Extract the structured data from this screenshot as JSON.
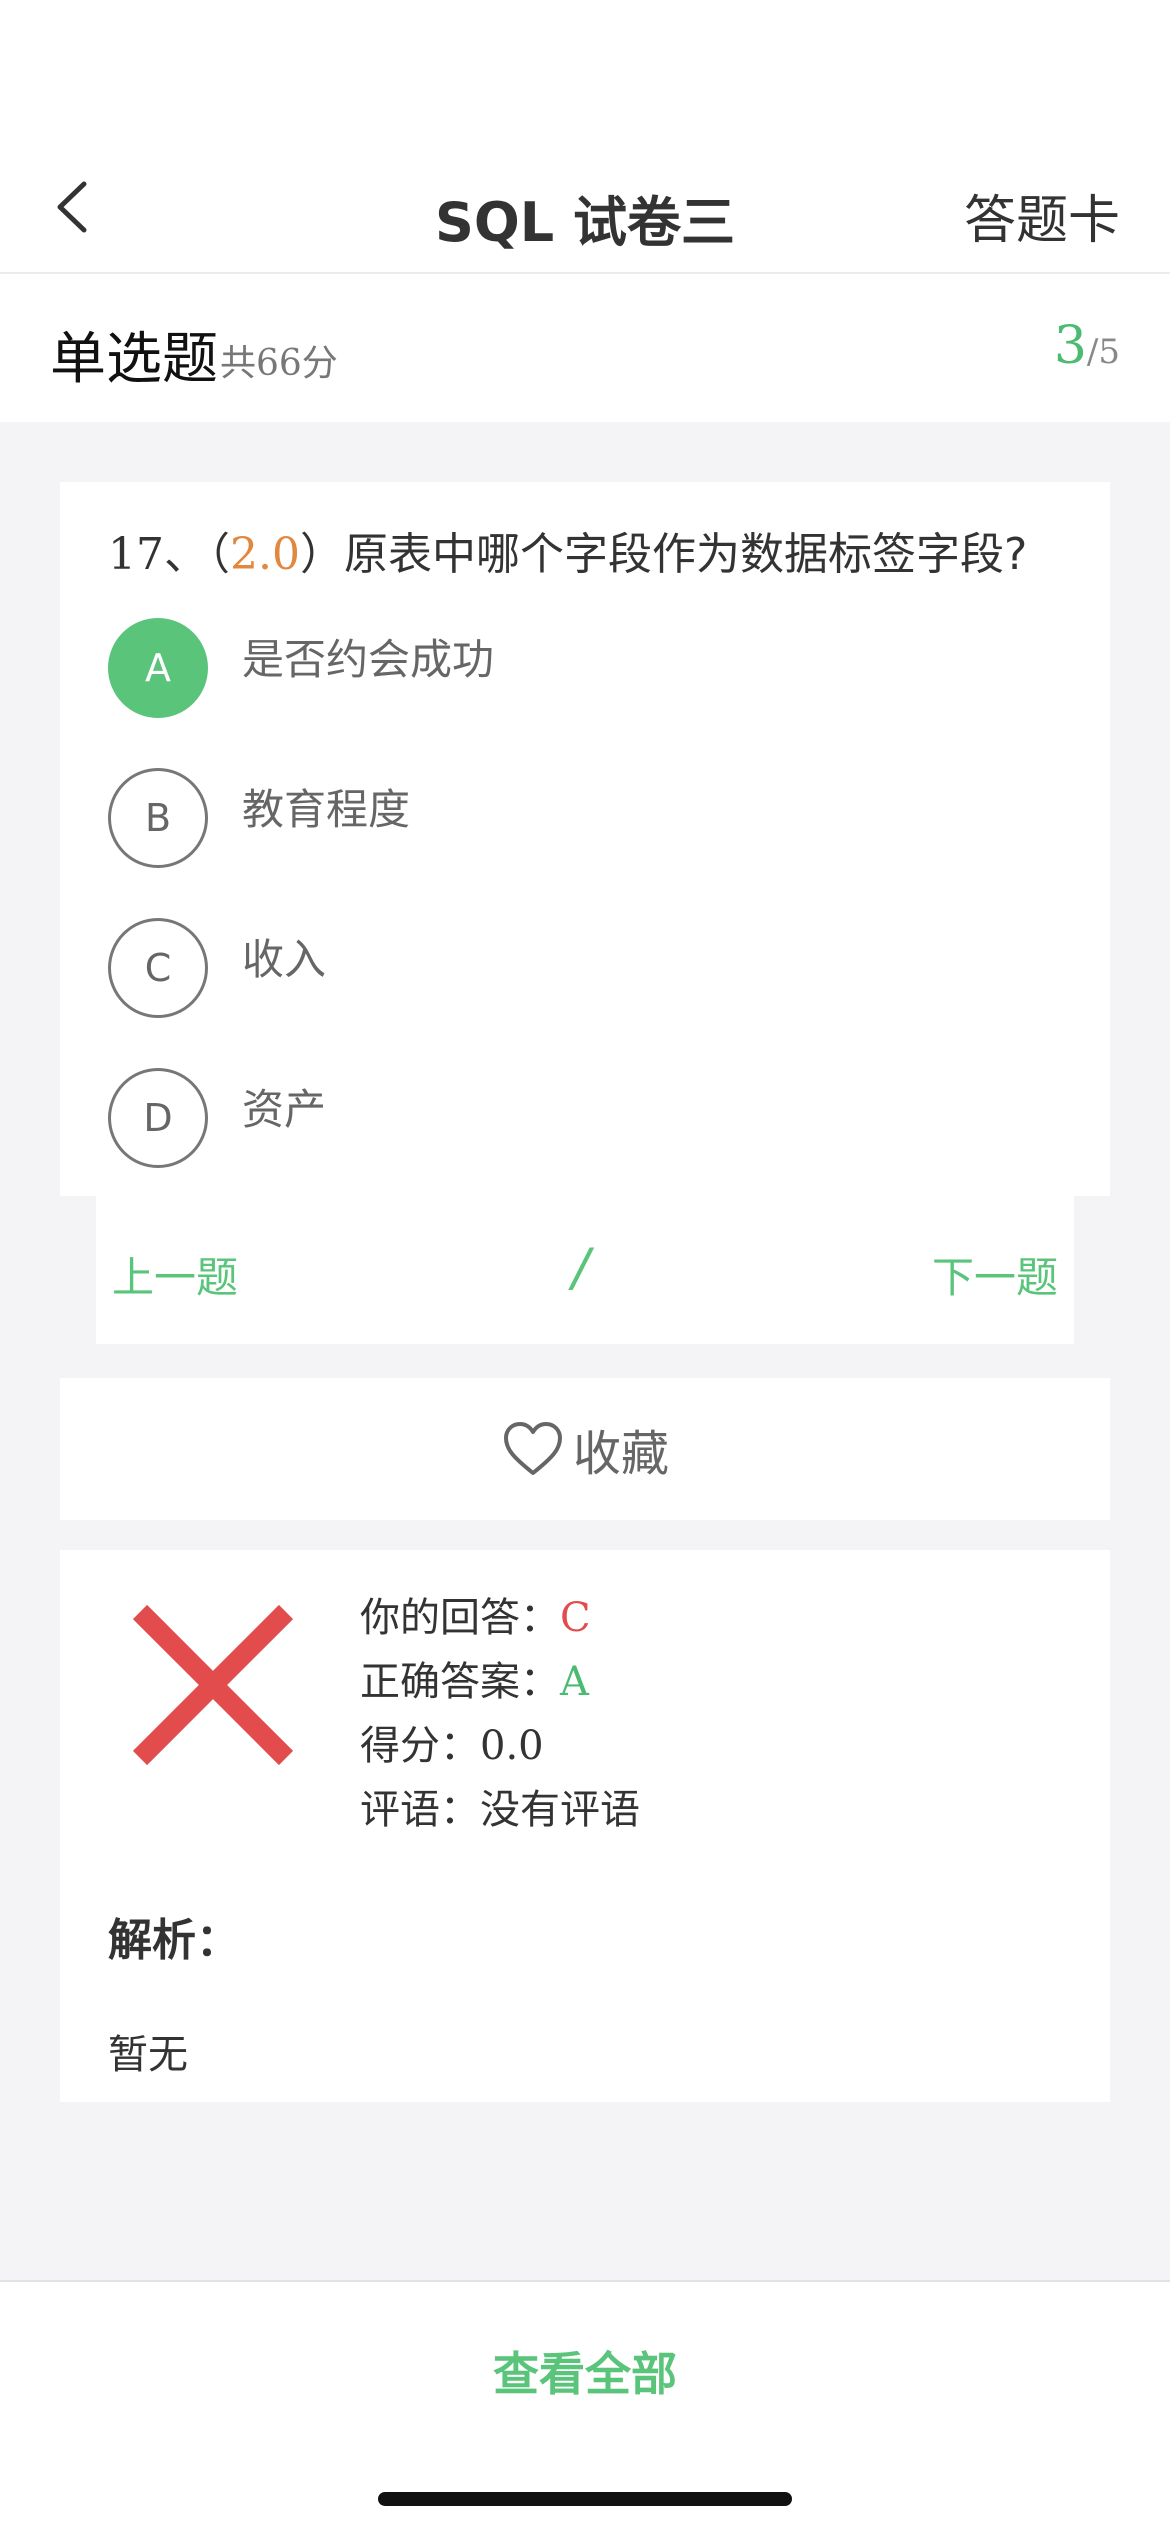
{
  "nav": {
    "title": "SQL 试卷三",
    "answer_card": "答题卡"
  },
  "section": {
    "title": "单选题",
    "total": "共66分",
    "progress_current": "3",
    "progress_total": "/5"
  },
  "question": {
    "number": "17、",
    "score_open": "（",
    "score": "2.0",
    "score_close": "）",
    "text": "原表中哪个字段作为数据标签字段?",
    "options": [
      {
        "key": "A",
        "text": "是否约会成功",
        "selected": true
      },
      {
        "key": "B",
        "text": "教育程度",
        "selected": false
      },
      {
        "key": "C",
        "text": "收入",
        "selected": false
      },
      {
        "key": "D",
        "text": "资产",
        "selected": false
      }
    ]
  },
  "pager": {
    "prev": "上一题",
    "separator": "/",
    "next": "下一题"
  },
  "favorite": {
    "label": "收藏",
    "icon": "heart-outline-icon"
  },
  "result": {
    "your_answer_label": "你的回答：",
    "your_answer": "C",
    "correct_label": "正确答案：",
    "correct_answer": "A",
    "score_label": "得分：",
    "score": "0.0",
    "comment_label": "评语：",
    "comment": "没有评语",
    "status_icon": "wrong-cross-icon"
  },
  "analysis": {
    "title": "解析：",
    "body": "暂无"
  },
  "bottom": {
    "view_all": "查看全部"
  },
  "colors": {
    "accent_green": "#59c47a",
    "wrong_red": "#e24c4c",
    "score_orange": "#e2873e"
  }
}
